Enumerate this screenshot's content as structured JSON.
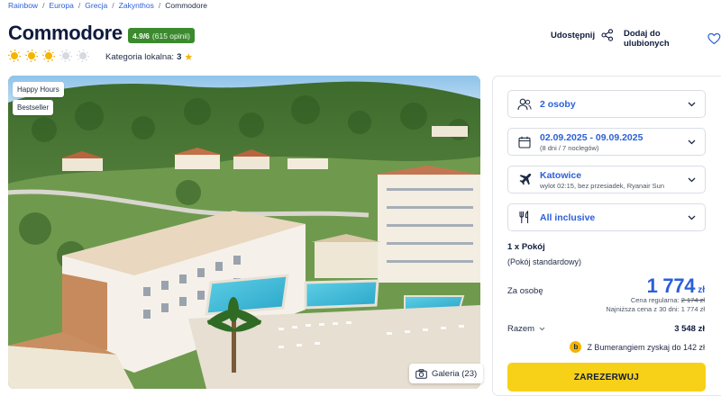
{
  "breadcrumb": {
    "items": [
      "Rainbow",
      "Europa",
      "Grecja",
      "Zakynthos"
    ],
    "current": "Commodore",
    "separator": "/"
  },
  "hotel": {
    "name": "Commodore",
    "rating_score": "4.9/6",
    "rating_count": "(615 opinii)",
    "suns_total": 5,
    "suns_filled": 3,
    "local_category_label": "Kategoria lokalna:",
    "local_category_value": "3"
  },
  "actions": {
    "share_label": "Udostępnij",
    "favorite_label": "Dodaj do ulubionych"
  },
  "photo": {
    "tags": [
      "Happy Hours",
      "Bestseller"
    ],
    "gallery_label": "Galeria (23)"
  },
  "booking": {
    "persons": "2 osoby",
    "dates": "02.09.2025 - 09.09.2025",
    "dates_sub": "(8 dni / 7 noclegów)",
    "departure": "Katowice",
    "departure_sub": "wylot 02:15, bez przesiadek, Ryanair Sun",
    "board": "All inclusive",
    "room_title": "1 x Pokój",
    "room_sub": "(Pokój standardowy)",
    "per_person_label": "Za osobę",
    "price": "1 774",
    "currency": "zł",
    "regular_label": "Cena regularna:",
    "regular_price": "2 174 zł",
    "lowest_label": "Najniższa cena z 30 dni: 1 774 zł",
    "total_label": "Razem",
    "total_value": "3 548 zł",
    "bumerang_logo": "b",
    "bumerang_text": "Z Bumerangiem zyskaj do 142 zł",
    "reserve_label": "ZAREZERWUJ"
  },
  "colors": {
    "link": "#2b5fd9",
    "rating_green": "#3c8a2e",
    "sun": "#f5b400",
    "reserve_yellow": "#f7d117"
  }
}
